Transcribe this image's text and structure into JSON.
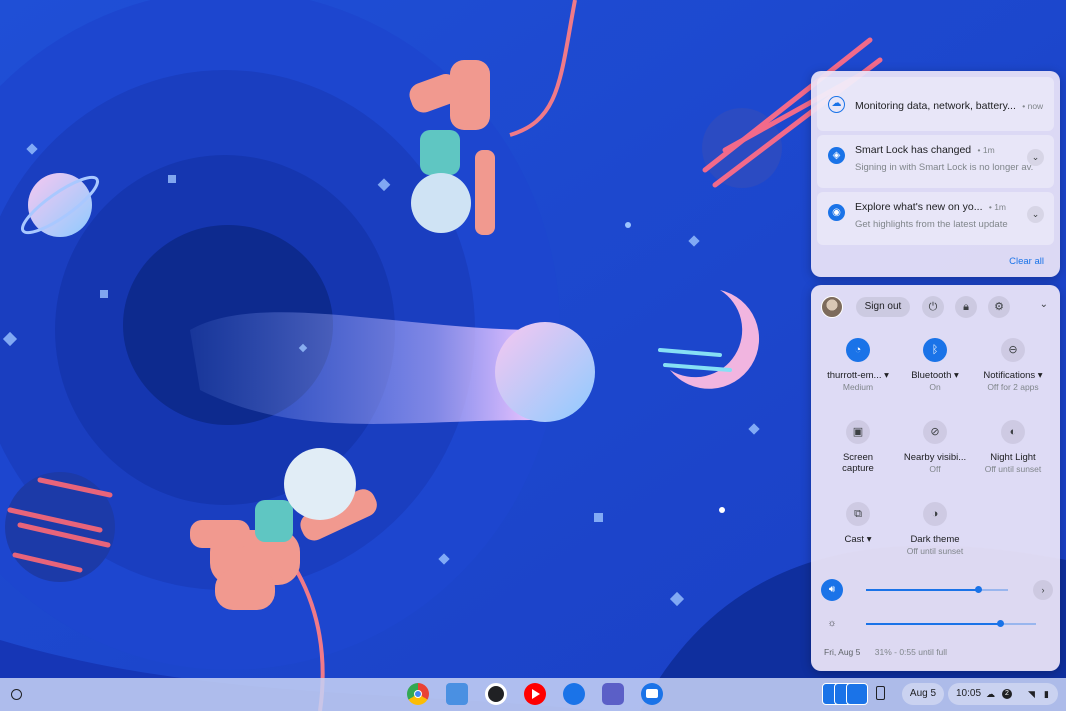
{
  "notifications": {
    "items": [
      {
        "title": "Monitoring data, network, battery...",
        "time": "now",
        "body": ""
      },
      {
        "title": "Smart Lock has changed",
        "time": "1m",
        "body": "Signing in with Smart Lock is no longer av..."
      },
      {
        "title": "Explore what's new on yo...",
        "time": "1m",
        "body": "Get highlights from the latest update"
      }
    ],
    "clear_all": "Clear all"
  },
  "quick_settings": {
    "sign_out": "Sign out",
    "tiles": [
      {
        "label": "thurrott-em...",
        "dropdown": "▾",
        "sub": "Medium",
        "icon": "wifi-icon",
        "active": true
      },
      {
        "label": "Bluetooth",
        "dropdown": "▾",
        "sub": "On",
        "icon": "bluetooth-icon",
        "active": true
      },
      {
        "label": "Notifications",
        "dropdown": "▾",
        "sub": "Off for 2 apps",
        "icon": "do-not-disturb-icon",
        "active": false
      },
      {
        "label": "Screen",
        "label2": "capture",
        "sub": "",
        "icon": "screen-capture-icon",
        "active": false
      },
      {
        "label": "Nearby visibi...",
        "sub": "Off",
        "icon": "nearby-visibility-icon",
        "active": false
      },
      {
        "label": "Night Light",
        "sub": "Off until sunset",
        "icon": "night-light-icon",
        "active": false
      },
      {
        "label": "Cast",
        "dropdown": "▾",
        "sub": "",
        "icon": "cast-icon",
        "active": false
      },
      {
        "label": "Dark theme",
        "sub": "Off until sunset",
        "icon": "dark-theme-icon",
        "active": false
      }
    ],
    "volume_level": 0.79,
    "brightness_level": 0.79,
    "footer_date": "Fri, Aug 5",
    "battery_text": "31% - 0:55 until full"
  },
  "shelf": {
    "apps": [
      "Chrome",
      "Files",
      "Camera",
      "YouTube Music",
      "Chrome Canvas",
      "Microsoft Teams",
      "Messages"
    ],
    "date": "Aug 5",
    "time": "10:05",
    "badge": "2"
  },
  "colors": {
    "accent": "#1a73e8",
    "wallpaper_deep": "#0b2aa8",
    "wallpaper_mid": "#1f4fd6"
  }
}
